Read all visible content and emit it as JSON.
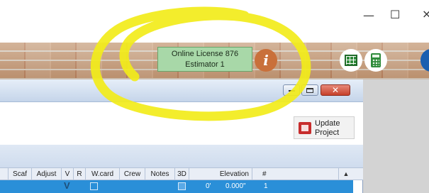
{
  "window_controls": {
    "minimize": "—",
    "maximize": "☐",
    "close": "×"
  },
  "license": {
    "line1": "Online License 876",
    "line2": "Estimator 1"
  },
  "info_button": "i",
  "update_button": {
    "line1": "Update",
    "line2": "Project"
  },
  "inner_window_controls": {
    "minimize": "▬",
    "restore": "▭",
    "close": "✕"
  },
  "table": {
    "headers": [
      "Scaf",
      "Adjust",
      "V",
      "R",
      "W.card",
      "Crew",
      "Notes",
      "3D",
      "Elevation",
      "#"
    ],
    "row": {
      "v": "V",
      "elevation_feet": "0'",
      "elevation_inches": "0.000\"",
      "number": "1"
    }
  },
  "scroll_up": "▲",
  "colors": {
    "license_bg": "#a8d8a8",
    "info_orange": "#c9703a",
    "selected_row": "#2a8fd8",
    "highlight_ring": "#f2ec1a"
  }
}
